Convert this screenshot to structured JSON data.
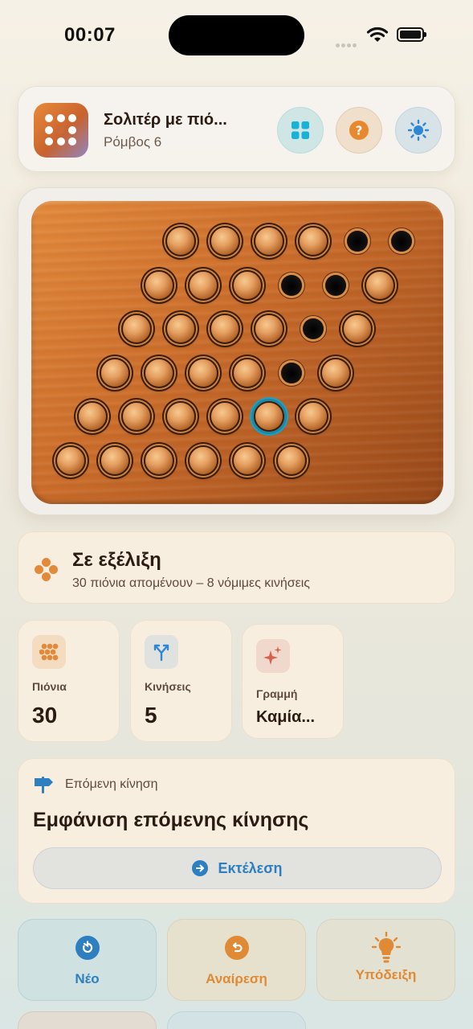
{
  "status_bar": {
    "time": "00:07"
  },
  "header": {
    "title": "Σολιτέρ με πιό...",
    "subtitle": "Ρόμβος 6",
    "buttons": [
      {
        "icon": "grid-icon",
        "color": "#17b3d6"
      },
      {
        "icon": "help-icon",
        "color": "#e8892f"
      },
      {
        "icon": "sun-icon",
        "color": "#2d86d6"
      }
    ]
  },
  "board": {
    "shape": "rhombus",
    "rows": [
      [
        "peg",
        "peg",
        "peg",
        "peg",
        "hole",
        "hole"
      ],
      [
        "peg",
        "peg",
        "peg",
        "hole",
        "hole",
        "peg"
      ],
      [
        "peg",
        "peg",
        "peg",
        "peg",
        "hole",
        "peg"
      ],
      [
        "peg",
        "peg",
        "peg",
        "peg",
        "hole",
        "peg"
      ],
      [
        "peg",
        "peg",
        "peg",
        "peg",
        "peg-selected",
        "peg"
      ],
      [
        "peg",
        "peg",
        "peg",
        "peg",
        "peg",
        "peg"
      ]
    ]
  },
  "progress": {
    "heading": "Σε εξέλιξη",
    "detail": "30 πιόνια απομένουν – 8 νόμιμες κινήσεις"
  },
  "stats": [
    {
      "label": "Πιόνια",
      "value": "30",
      "icon": "pegs-icon"
    },
    {
      "label": "Κινήσεις",
      "value": "5",
      "icon": "moves-icon"
    },
    {
      "label": "Γραμμή",
      "value": "Καμία...",
      "icon": "sparkle-icon"
    }
  ],
  "next_move": {
    "label": "Επόμενη κίνηση",
    "heading": "Εμφάνιση επόμενης κίνησης",
    "run_label": "Εκτέλεση"
  },
  "actions": [
    {
      "label": "Νέο",
      "icon": "restart-icon"
    },
    {
      "label": "Αναίρεση",
      "icon": "undo-icon"
    },
    {
      "label": "Υπόδειξη",
      "icon": "lightbulb-icon"
    }
  ],
  "colors": {
    "accent_blue": "#2d7fc0",
    "accent_orange": "#e08a36",
    "text_dark": "#2a1c12",
    "selected_ring": "#1ea0c0"
  }
}
